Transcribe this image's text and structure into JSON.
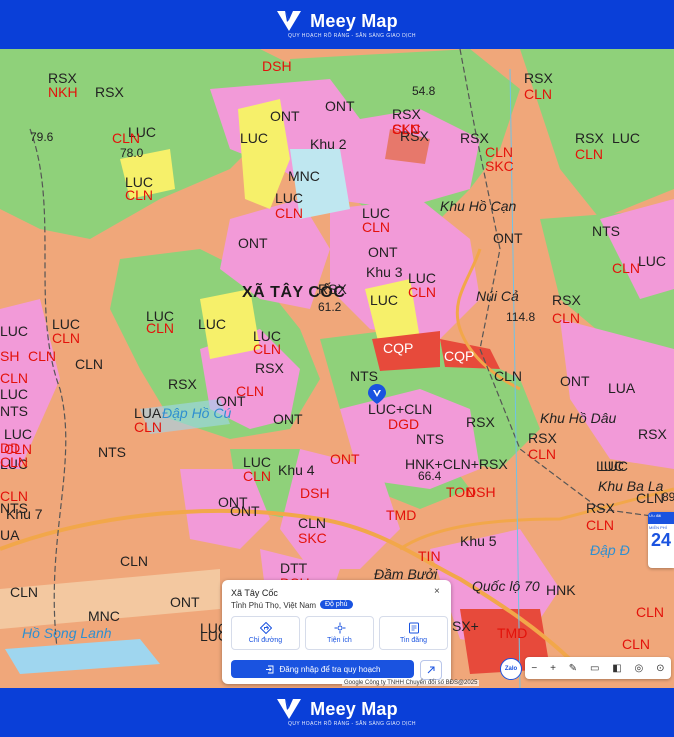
{
  "brand": {
    "name": "Meey Map",
    "tagline": "QUY HOẠCH RÕ RÀNG - SẴN SÀNG GIAO DỊCH"
  },
  "colors": {
    "brand_blue": "#0a3fd8",
    "button_blue": "#1a53e0",
    "pink": "#f29ad8",
    "green": "#8fd17a",
    "orange": "#f0a77a",
    "yellow": "#f6f06a",
    "red_zone": "#e74a3b"
  },
  "map": {
    "commune_label": "XÃ TÂY CỐC",
    "codes": [
      {
        "t": "RSX",
        "cls": "code"
      },
      {
        "t": "NKH",
        "cls": "red"
      },
      {
        "t": "RSX",
        "cls": "code"
      },
      {
        "t": "DSH",
        "cls": "red"
      },
      {
        "t": "54.8",
        "cls": "num"
      },
      {
        "t": "RSX",
        "cls": "code"
      },
      {
        "t": "CLN",
        "cls": "red"
      },
      {
        "t": "RSX",
        "cls": "code"
      },
      {
        "t": "CLN",
        "cls": "red"
      },
      {
        "t": "79.6",
        "cls": "num"
      },
      {
        "t": "LUC",
        "cls": "code"
      },
      {
        "t": "CLN",
        "cls": "red"
      },
      {
        "t": "78.0",
        "cls": "num"
      },
      {
        "t": "ONT",
        "cls": "code"
      },
      {
        "t": "RSX",
        "cls": "code"
      },
      {
        "t": "SKC",
        "cls": "red"
      },
      {
        "t": "RSX",
        "cls": "code"
      },
      {
        "t": "RSX",
        "cls": "code"
      },
      {
        "t": "LUC",
        "cls": "code"
      },
      {
        "t": "CLN",
        "cls": "red"
      },
      {
        "t": "SKC",
        "cls": "red"
      },
      {
        "t": "CLN",
        "cls": "red"
      },
      {
        "t": "LUC",
        "cls": "code"
      },
      {
        "t": "ONT",
        "cls": "code"
      },
      {
        "t": "Khu 2",
        "cls": "place"
      },
      {
        "t": "MNC",
        "cls": "code"
      },
      {
        "t": "LUC",
        "cls": "code"
      },
      {
        "t": "CLN",
        "cls": "red"
      },
      {
        "t": "LUC",
        "cls": "code"
      },
      {
        "t": "CLN",
        "cls": "red"
      },
      {
        "t": "LUC",
        "cls": "code"
      },
      {
        "t": "CLN",
        "cls": "red"
      },
      {
        "t": "Khu Hồ Cạn",
        "cls": "place-i"
      },
      {
        "t": "NTS",
        "cls": "code"
      },
      {
        "t": "LUC",
        "cls": "code"
      },
      {
        "t": "CLN",
        "cls": "red"
      },
      {
        "t": "ONT",
        "cls": "code"
      },
      {
        "t": "ONT",
        "cls": "code"
      },
      {
        "t": "ONT",
        "cls": "code"
      },
      {
        "t": "Khu 3",
        "cls": "place"
      },
      {
        "t": "LUC",
        "cls": "code"
      },
      {
        "t": "CLN",
        "cls": "red"
      },
      {
        "t": "LUC",
        "cls": "code"
      },
      {
        "t": "RSX",
        "cls": "code"
      },
      {
        "t": "61.2",
        "cls": "num"
      },
      {
        "t": "LUC",
        "cls": "code"
      },
      {
        "t": "Núi Cả",
        "cls": "place-i"
      },
      {
        "t": "RSX",
        "cls": "code"
      },
      {
        "t": "CLN",
        "cls": "red"
      },
      {
        "t": "114.8",
        "cls": "num"
      },
      {
        "t": "LUC",
        "cls": "code"
      },
      {
        "t": "CLN",
        "cls": "red"
      },
      {
        "t": "LUC",
        "cls": "code"
      },
      {
        "t": "CLN",
        "cls": "red"
      },
      {
        "t": "LUC",
        "cls": "code"
      },
      {
        "t": "LUC",
        "cls": "code"
      },
      {
        "t": "CLN",
        "cls": "red"
      },
      {
        "t": "CQP",
        "cls": "white"
      },
      {
        "t": "CQP",
        "cls": "white"
      },
      {
        "t": "CLN",
        "cls": "code"
      },
      {
        "t": "RSX",
        "cls": "code"
      },
      {
        "t": "NTS",
        "cls": "code"
      },
      {
        "t": "CLN",
        "cls": "code"
      },
      {
        "t": "ONT",
        "cls": "code"
      },
      {
        "t": "LUA",
        "cls": "code"
      },
      {
        "t": "RSX",
        "cls": "code"
      },
      {
        "t": "ONT",
        "cls": "code"
      },
      {
        "t": "LUC+CLN",
        "cls": "code"
      },
      {
        "t": "DGD",
        "cls": "red"
      },
      {
        "t": "LUA",
        "cls": "code"
      },
      {
        "t": "CLN",
        "cls": "red"
      },
      {
        "t": "Đập Hồ Cú",
        "cls": "water"
      },
      {
        "t": "ONT",
        "cls": "code"
      },
      {
        "t": "RSX",
        "cls": "code"
      },
      {
        "t": "Khu Hồ Dâu",
        "cls": "place-i"
      },
      {
        "t": "RSX",
        "cls": "code"
      },
      {
        "t": "CLN",
        "cls": "red"
      },
      {
        "t": "RSX",
        "cls": "code"
      },
      {
        "t": "LUC",
        "cls": "code"
      },
      {
        "t": "CLN",
        "cls": "red"
      },
      {
        "t": "NTS",
        "cls": "code"
      },
      {
        "t": "NTS",
        "cls": "code"
      },
      {
        "t": "ONT",
        "cls": "red"
      },
      {
        "t": "LUC",
        "cls": "code"
      },
      {
        "t": "CLN",
        "cls": "red"
      },
      {
        "t": "Khu 4",
        "cls": "place"
      },
      {
        "t": "HNK+CLN+RSX",
        "cls": "code"
      },
      {
        "t": "66.4",
        "cls": "num"
      },
      {
        "t": "TON",
        "cls": "red"
      },
      {
        "t": "DSH",
        "cls": "red"
      },
      {
        "t": "DSH",
        "cls": "red"
      },
      {
        "t": "Khu Ba La",
        "cls": "place-i"
      },
      {
        "t": "CLN",
        "cls": "code"
      },
      {
        "t": "ONT",
        "cls": "code"
      },
      {
        "t": "Khu 7",
        "cls": "place"
      },
      {
        "t": "UA",
        "cls": "code"
      },
      {
        "t": "TMD",
        "cls": "red"
      },
      {
        "t": "RSX",
        "cls": "code"
      },
      {
        "t": "CLN",
        "cls": "red"
      },
      {
        "t": "CLN",
        "cls": "code"
      },
      {
        "t": "SKC",
        "cls": "red"
      },
      {
        "t": "Khu 5",
        "cls": "place"
      },
      {
        "t": "Đập Đ",
        "cls": "water"
      },
      {
        "t": "CLN",
        "cls": "code"
      },
      {
        "t": "DTT",
        "cls": "code"
      },
      {
        "t": "DSH",
        "cls": "red"
      },
      {
        "t": "TIN",
        "cls": "red"
      },
      {
        "t": "Đầm Bưởi",
        "cls": "place-i"
      },
      {
        "t": "CLN",
        "cls": "code"
      },
      {
        "t": "HNK",
        "cls": "code"
      },
      {
        "t": "MNC",
        "cls": "code"
      },
      {
        "t": "ONT",
        "cls": "code"
      },
      {
        "t": "Quốc lộ 70",
        "cls": "place-i"
      },
      {
        "t": "Hồ Song Lanh",
        "cls": "water"
      },
      {
        "t": "TMD",
        "cls": "red"
      },
      {
        "t": "LUC",
        "cls": "code"
      },
      {
        "t": "KC",
        "cls": "red"
      },
      {
        "t": "SX+",
        "cls": "code"
      },
      {
        "t": "NTS",
        "cls": "code"
      },
      {
        "t": "LUC",
        "cls": "code"
      },
      {
        "t": "CLN",
        "cls": "red"
      },
      {
        "t": "LUC",
        "cls": "code"
      },
      {
        "t": "CLN",
        "cls": "red"
      },
      {
        "t": "NTS",
        "cls": "code"
      },
      {
        "t": "LUC",
        "cls": "code"
      },
      {
        "t": "LUC",
        "cls": "code"
      },
      {
        "t": "CLN",
        "cls": "red"
      },
      {
        "t": "CLN",
        "cls": "red"
      },
      {
        "t": "ONT",
        "cls": "code"
      },
      {
        "t": "LUC",
        "cls": "code"
      },
      {
        "t": "89",
        "cls": "num"
      },
      {
        "t": "CLN",
        "cls": "red"
      },
      {
        "t": "SH",
        "cls": "red"
      },
      {
        "t": "DD",
        "cls": "red"
      },
      {
        "t": "CLN",
        "cls": "red"
      },
      {
        "t": "CLN",
        "cls": "red"
      }
    ]
  },
  "popup": {
    "title": "Xã Tây Cốc",
    "subtitle": "Tỉnh Phú Thọ, Việt Nam",
    "badge": "Độ phủ",
    "close": "×",
    "actions": [
      {
        "label": "Chỉ đường",
        "icon": "directions-icon"
      },
      {
        "label": "Tiện ích",
        "icon": "utilities-icon"
      },
      {
        "label": "Tin đăng",
        "icon": "listings-icon"
      }
    ],
    "login_label": "Đăng nhập để tra quy hoạch",
    "share_icon": "share-icon"
  },
  "attribution": {
    "google": "Google",
    "text": "Công ty TNHH Chuyển đổi số BĐS@2025"
  },
  "controls": {
    "zalo": "Zalo",
    "tools": [
      "−",
      "+",
      "✎",
      "▭",
      "◧",
      "◎",
      "⊙"
    ]
  },
  "side_card": {
    "header": "Ưu đãi",
    "sub": "MIỄN PHÍ",
    "number": "24"
  }
}
